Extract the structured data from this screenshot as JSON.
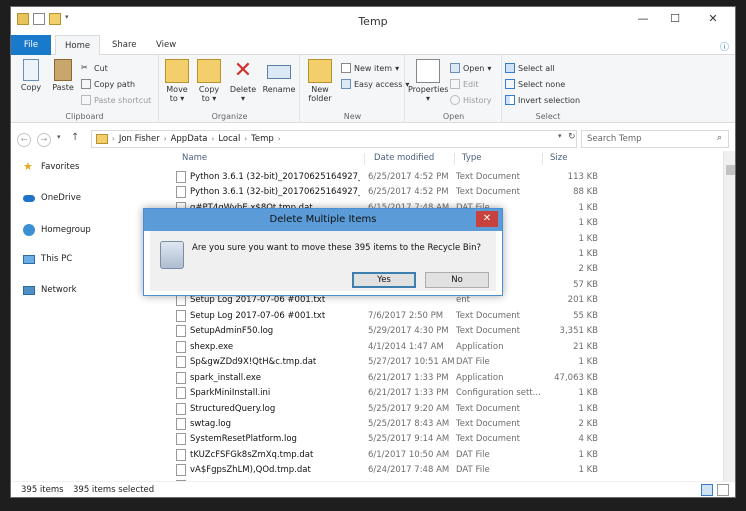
{
  "window": {
    "title": "Temp"
  },
  "tabs": {
    "file": "File",
    "home": "Home",
    "share": "Share",
    "view": "View"
  },
  "ribbon": {
    "clipboard": {
      "label": "Clipboard",
      "copy": "Copy",
      "paste": "Paste",
      "cut": "Cut",
      "copy_path": "Copy path",
      "paste_shortcut": "Paste shortcut"
    },
    "organize": {
      "label": "Organize",
      "move_to": "Move to",
      "copy_to": "Copy to",
      "delete": "Delete",
      "rename": "Rename"
    },
    "new": {
      "label": "New",
      "new_folder": "New folder",
      "new_item": "New item",
      "easy_access": "Easy access"
    },
    "open": {
      "label": "Open",
      "properties": "Properties",
      "open": "Open",
      "edit": "Edit",
      "history": "History"
    },
    "select": {
      "label": "Select",
      "select_all": "Select all",
      "select_none": "Select none",
      "invert": "Invert selection"
    }
  },
  "address": {
    "crumbs": [
      "Jon Fisher",
      "AppData",
      "Local",
      "Temp"
    ],
    "search_placeholder": "Search Temp"
  },
  "nav": {
    "favorites": "Favorites",
    "onedrive": "OneDrive",
    "homegroup": "Homegroup",
    "this_pc": "This PC",
    "network": "Network"
  },
  "columns": {
    "name": "Name",
    "date": "Date modified",
    "type": "Type",
    "size": "Size"
  },
  "files": [
    {
      "name": "Python 3.6.1 (32-bit)_20170625164927_00...",
      "date": "6/25/2017 4:52 PM",
      "type": "Text Document",
      "size": "113 KB"
    },
    {
      "name": "Python 3.6.1 (32-bit)_20170625164927_01...",
      "date": "6/25/2017 4:52 PM",
      "type": "Text Document",
      "size": "88 KB"
    },
    {
      "name": "q#PT4qWybE,x$8Qt.tmp.dat",
      "date": "6/15/2017 7:48 AM",
      "type": "DAT File",
      "size": "1 KB"
    },
    {
      "name": "",
      "date": "",
      "type": "",
      "size": "1 KB"
    },
    {
      "name": "",
      "date": "",
      "type": "",
      "size": "1 KB"
    },
    {
      "name": "",
      "date": "",
      "type": "",
      "size": "1 KB"
    },
    {
      "name": "",
      "date": "",
      "type": "ent",
      "size": "2 KB"
    },
    {
      "name": "",
      "date": "",
      "type": "ent",
      "size": "57 KB"
    },
    {
      "name": "Setup Log 2017-07-06 #001.txt",
      "date": "",
      "type": "ent",
      "size": "201 KB"
    },
    {
      "name": "Setup Log 2017-07-06 #001.txt",
      "date": "7/6/2017 2:50 PM",
      "type": "Text Document",
      "size": "55 KB"
    },
    {
      "name": "SetupAdminF50.log",
      "date": "5/29/2017 4:30 PM",
      "type": "Text Document",
      "size": "3,351 KB"
    },
    {
      "name": "shexp.exe",
      "date": "4/1/2014 1:47 AM",
      "type": "Application",
      "size": "21 KB"
    },
    {
      "name": "Sp&gwZDd9X!QtH&c.tmp.dat",
      "date": "5/27/2017 10:51 AM",
      "type": "DAT File",
      "size": "1 KB"
    },
    {
      "name": "spark_install.exe",
      "date": "6/21/2017 1:33 PM",
      "type": "Application",
      "size": "47,063 KB"
    },
    {
      "name": "SparkMiniInstall.ini",
      "date": "6/21/2017 1:33 PM",
      "type": "Configuration sett...",
      "size": "1 KB"
    },
    {
      "name": "StructuredQuery.log",
      "date": "5/25/2017 9:20 AM",
      "type": "Text Document",
      "size": "1 KB"
    },
    {
      "name": "swtag.log",
      "date": "5/25/2017 8:43 AM",
      "type": "Text Document",
      "size": "2 KB"
    },
    {
      "name": "SystemResetPlatform.log",
      "date": "5/25/2017 9:14 AM",
      "type": "Text Document",
      "size": "4 KB"
    },
    {
      "name": "tKUZcFSFGk8sZmXq.tmp.dat",
      "date": "6/1/2017 10:50 AM",
      "type": "DAT File",
      "size": "1 KB"
    },
    {
      "name": "vA$FgpsZhLM),QOd.tmp.dat",
      "date": "6/24/2017 7:48 AM",
      "type": "DAT File",
      "size": "1 KB"
    },
    {
      "name": "",
      "date": "",
      "type": "",
      "size": "1 KB"
    }
  ],
  "status": {
    "count": "395 items",
    "selected": "395 items selected"
  },
  "dialog": {
    "title": "Delete Multiple Items",
    "message": "Are you sure you want to move these 395 items to the Recycle Bin?",
    "yes": "Yes",
    "no": "No"
  }
}
